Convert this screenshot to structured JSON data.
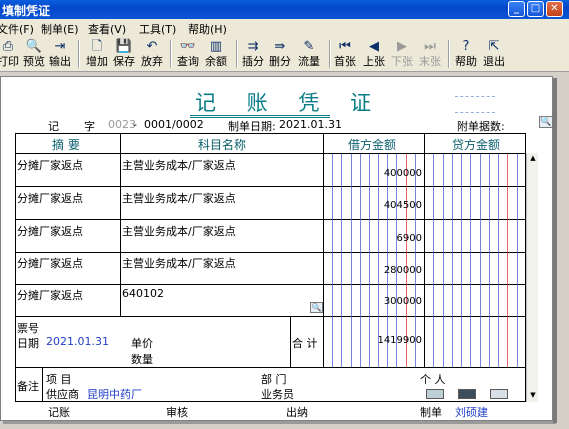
{
  "window": {
    "title": "填制凭证"
  },
  "menu": [
    "文件(F)",
    "制单(E)",
    "查看(V)",
    "工具(T)",
    "帮助(H)"
  ],
  "toolbar": [
    {
      "icon": "print-icon",
      "label": "打印",
      "enabled": true
    },
    {
      "icon": "preview-icon",
      "label": "预览",
      "enabled": true
    },
    {
      "icon": "export-icon",
      "label": "输出",
      "enabled": true
    },
    {
      "icon": "add-icon",
      "label": "增加",
      "enabled": true
    },
    {
      "icon": "save-icon",
      "label": "保存",
      "enabled": true
    },
    {
      "icon": "undo-icon",
      "label": "放弃",
      "enabled": true
    },
    {
      "icon": "binoculars-icon",
      "label": "查询",
      "enabled": true
    },
    {
      "icon": "balance-icon",
      "label": "余额",
      "enabled": true
    },
    {
      "icon": "insert-row-icon",
      "label": "插分",
      "enabled": true
    },
    {
      "icon": "delete-row-icon",
      "label": "删分",
      "enabled": true
    },
    {
      "icon": "cashflow-icon",
      "label": "流量",
      "enabled": true
    },
    {
      "icon": "first-icon",
      "label": "首张",
      "enabled": true
    },
    {
      "icon": "prev-icon",
      "label": "上张",
      "enabled": true
    },
    {
      "icon": "next-icon",
      "label": "下张",
      "enabled": false
    },
    {
      "icon": "last-icon",
      "label": "末张",
      "enabled": false
    },
    {
      "icon": "help-icon",
      "label": "帮助",
      "enabled": true
    },
    {
      "icon": "exit-icon",
      "label": "退出",
      "enabled": true
    }
  ],
  "voucher": {
    "title": "记 账 凭 证",
    "type_label": "记",
    "zi_label": "字",
    "number": "0023",
    "sequence": "0001/0002",
    "date_label": "制单日期:",
    "date": "2021.01.31",
    "attachments_label": "附单据数:",
    "columns": {
      "summary": "摘 要",
      "account": "科目名称",
      "debit": "借方金额",
      "credit": "贷方金额"
    },
    "rows": [
      {
        "summary": "分摊厂家返点",
        "account": "主营业务成本/厂家返点",
        "debit": "400000",
        "credit": ""
      },
      {
        "summary": "分摊厂家返点",
        "account": "主营业务成本/厂家返点",
        "debit": "404500",
        "credit": ""
      },
      {
        "summary": "分摊厂家返点",
        "account": "主营业务成本/厂家返点",
        "debit": "6900",
        "credit": ""
      },
      {
        "summary": "分摊厂家返点",
        "account": "主营业务成本/厂家返点",
        "debit": "280000",
        "credit": ""
      },
      {
        "summary": "分摊厂家返点",
        "account": "640102",
        "debit": "300000",
        "credit": ""
      }
    ],
    "ticket_label": "票号",
    "date2_label": "日期",
    "date2": "2021.01.31",
    "unit_price_label": "单价",
    "quantity_label": "数量",
    "total_label": "合 计",
    "total_debit": "1419900",
    "remarks_label": "备注",
    "project_label": "项 目",
    "department_label": "部 门",
    "person_label": "个 人",
    "supplier_label": "供应商",
    "supplier_value": "昆明中药厂",
    "salesman_label": "业务员"
  },
  "footer": {
    "bookkeeping_label": "记账",
    "review_label": "审核",
    "cashier_label": "出纳",
    "maker_label": "制单",
    "maker_value": "刘硕建"
  }
}
